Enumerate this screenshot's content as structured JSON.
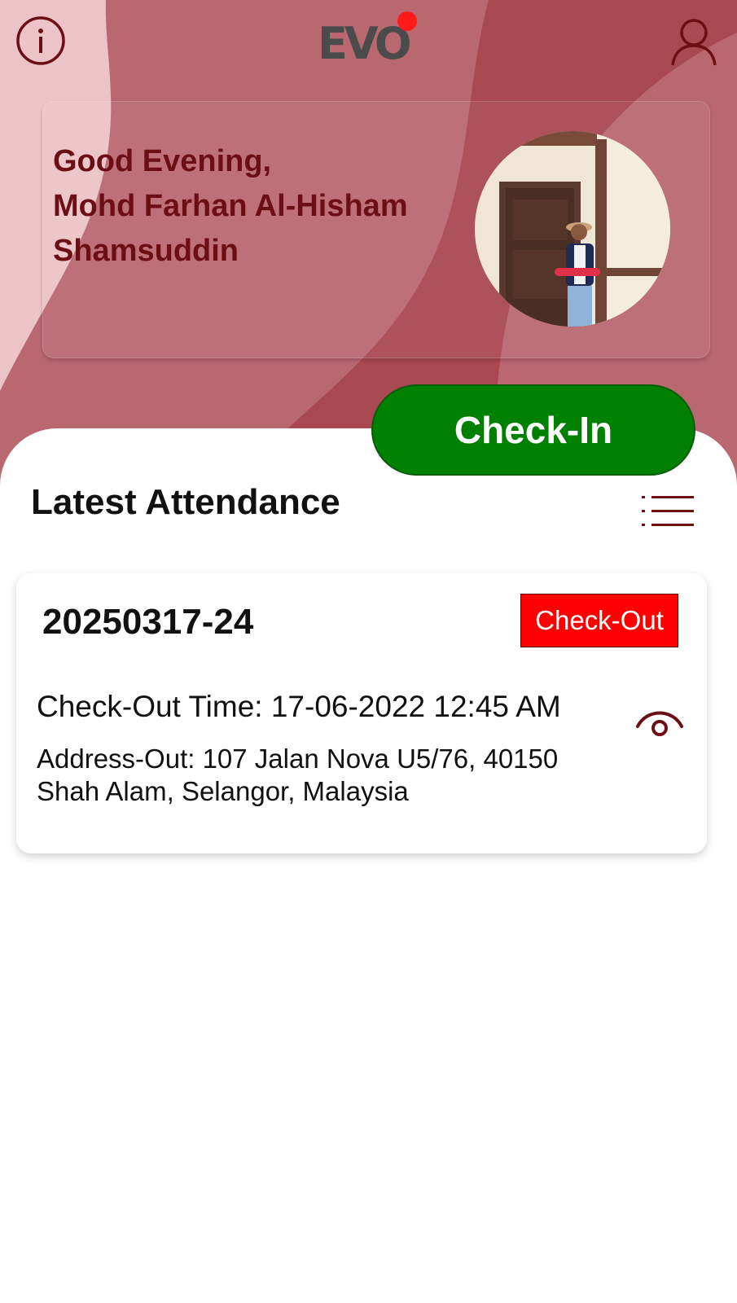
{
  "header": {
    "logo_text": "EVO",
    "info_icon": "info-circle-icon",
    "profile_icon": "user-profile-icon"
  },
  "greeting": {
    "line1": "Good Evening,",
    "line2": "Mohd Farhan Al-Hisham",
    "line3": "Shamsuddin"
  },
  "actions": {
    "checkin_label": "Check-In"
  },
  "attendance": {
    "section_title": "Latest Attendance",
    "list_icon": "list-icon",
    "records": [
      {
        "id": "20250317-24",
        "status": "Check-Out",
        "time_line": "Check-Out Time: 17-06-2022 12:45 AM",
        "address_line": "Address-Out: 107 Jalan Nova U5/76, 40150 Shah Alam, Selangor, Malaysia",
        "view_icon": "eye-icon"
      }
    ]
  },
  "colors": {
    "accent_dark": "#6b0f14",
    "checkin_green": "#008000",
    "status_red": "#ff0000",
    "hero_light": "#ecc3c6",
    "hero_mid": "#b96870",
    "hero_dark": "#a84851"
  }
}
